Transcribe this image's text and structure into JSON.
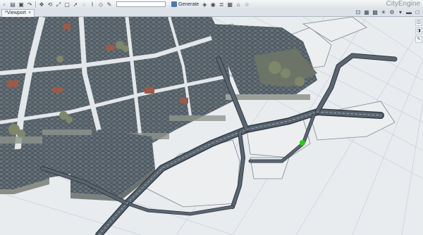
{
  "app_title": "CityEngine",
  "viewport_tab": {
    "label": "*Viewport",
    "close": "×"
  },
  "toolbar": {
    "left_icons": [
      {
        "name": "new-icon",
        "glyph": "▫"
      },
      {
        "name": "open-icon",
        "glyph": "▤"
      },
      {
        "name": "save-icon",
        "glyph": "▣"
      },
      {
        "name": "redo-icon",
        "glyph": "↷"
      },
      {
        "name": "move-icon",
        "glyph": "✥"
      },
      {
        "name": "rotate-icon",
        "glyph": "⟲"
      },
      {
        "name": "scale-icon",
        "glyph": "⤢"
      },
      {
        "name": "frame-icon",
        "glyph": "▢"
      },
      {
        "name": "select-icon",
        "glyph": "➚"
      },
      {
        "name": "lasso-icon",
        "glyph": "◌"
      },
      {
        "name": "draw-street-icon",
        "glyph": "⌇"
      },
      {
        "name": "draw-shape-icon",
        "glyph": "◇"
      },
      {
        "name": "edit-icon",
        "glyph": "✎"
      }
    ],
    "search_placeholder": "",
    "generate_label": "Generate",
    "right_icons": [
      {
        "name": "generate-icon",
        "glyph": "◈"
      },
      {
        "name": "cleanup-icon",
        "glyph": "◉"
      },
      {
        "name": "layers-icon",
        "glyph": "≣"
      },
      {
        "name": "grid-icon",
        "glyph": "▦"
      },
      {
        "name": "camera-icon",
        "glyph": "⌂"
      },
      {
        "name": "bookmark-icon",
        "glyph": "☆"
      }
    ]
  },
  "view_tools": [
    {
      "name": "fit-view-icon",
      "glyph": "⊡"
    },
    {
      "name": "wireframe-icon",
      "glyph": "▦"
    },
    {
      "name": "textures-icon",
      "glyph": "▩"
    },
    {
      "name": "lighting-icon",
      "glyph": "☀"
    },
    {
      "name": "settings-icon",
      "glyph": "⚙"
    },
    {
      "name": "menu-icon",
      "glyph": "▾"
    },
    {
      "name": "minimize-icon",
      "glyph": "▬"
    },
    {
      "name": "maximize-icon",
      "glyph": "□"
    }
  ],
  "side_tools": [
    {
      "name": "side-tool-a-icon",
      "glyph": "◫"
    },
    {
      "name": "side-tool-b-icon",
      "glyph": "◨"
    },
    {
      "name": "side-tool-c-icon",
      "glyph": "✎"
    }
  ],
  "colors": {
    "background": "#e9ecef",
    "road": "#5a6570",
    "road_edge": "#2f3a44",
    "lot": "#eceef0",
    "building_roof": "#55606a",
    "building_wall": "#8a8f86",
    "selection_marker": "#1fd400"
  }
}
